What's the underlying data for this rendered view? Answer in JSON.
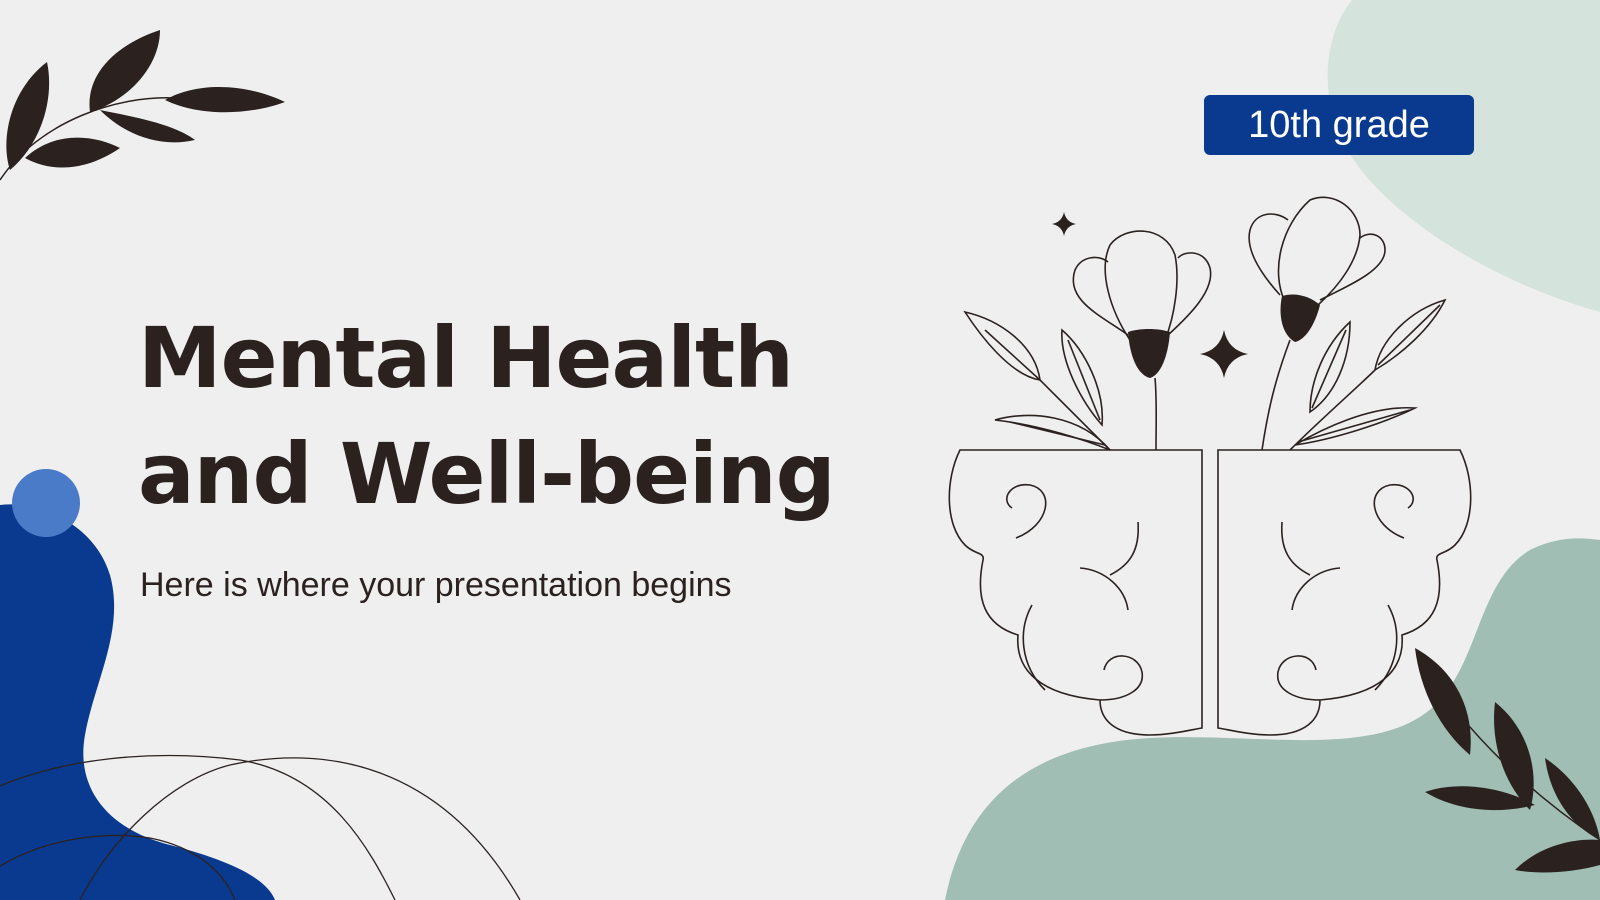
{
  "slide": {
    "title_line1": "Mental Health",
    "title_line2": "and Well-being",
    "subtitle": "Here is where your presentation begins",
    "badge": "10th grade"
  },
  "colors": {
    "background": "#efefef",
    "text": "#2b2220",
    "badge": "#0a3a8f",
    "navy_blob": "#0a3a8f",
    "blue_circle": "#4a7bc8",
    "mint_blob": "#d4e4dd",
    "sage_blob": "#a0beb4",
    "leaf": "#2b2220"
  },
  "decorations": {
    "leaves_top_left": "leaf-branch-icon",
    "leaves_bottom_right": "leaf-branch-icon",
    "brain": "brain-with-flowers-illustration",
    "sparkles": "sparkle-icon"
  }
}
